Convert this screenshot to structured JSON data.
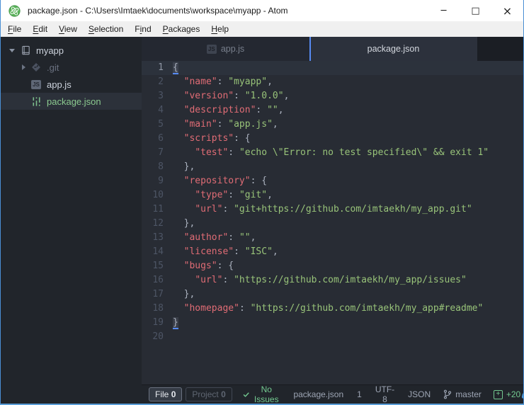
{
  "window": {
    "title": "package.json - C:\\Users\\Imtaek\\documents\\workspace\\myapp - Atom",
    "app_icon": "atom-logo",
    "controls": {
      "minimize": "─",
      "maximize": "□",
      "close": "×"
    }
  },
  "menu": {
    "items": [
      {
        "label": "File",
        "accel_index": 0
      },
      {
        "label": "Edit",
        "accel_index": 0
      },
      {
        "label": "View",
        "accel_index": 0
      },
      {
        "label": "Selection",
        "accel_index": 0
      },
      {
        "label": "Find",
        "accel_index": 1
      },
      {
        "label": "Packages",
        "accel_index": 0
      },
      {
        "label": "Help",
        "accel_index": 0
      }
    ]
  },
  "tree": {
    "root": {
      "label": "myapp",
      "icon": "repo-icon",
      "expanded": true
    },
    "items": [
      {
        "label": ".git",
        "icon": "git-folder-icon",
        "dim": true,
        "expandable": true
      },
      {
        "label": "app.js",
        "icon": "js-file-icon"
      },
      {
        "label": "package.json",
        "icon": "npm-package-icon",
        "selected": true,
        "git_status": "added"
      }
    ]
  },
  "tabs": [
    {
      "label": "app.js",
      "icon": "js-file-icon",
      "active": false
    },
    {
      "label": "package.json",
      "icon": "",
      "active": true
    }
  ],
  "editor": {
    "language": "JSON",
    "active_line": 1,
    "bracket_match_lines": [
      1,
      19
    ],
    "lines": [
      "{",
      "  \"name\": \"myapp\",",
      "  \"version\": \"1.0.0\",",
      "  \"description\": \"\",",
      "  \"main\": \"app.js\",",
      "  \"scripts\": {",
      "    \"test\": \"echo \\\"Error: no test specified\\\" && exit 1\"",
      "  },",
      "  \"repository\": {",
      "    \"type\": \"git\",",
      "    \"url\": \"git+https://github.com/imtaekh/my_app.git\"",
      "  },",
      "  \"author\": \"\",",
      "  \"license\": \"ISC\",",
      "  \"bugs\": {",
      "    \"url\": \"https://github.com/imtaekh/my_app/issues\"",
      "  },",
      "  \"homepage\": \"https://github.com/imtaekh/my_app#readme\"",
      "}",
      ""
    ]
  },
  "statusbar": {
    "file_issues": {
      "label": "File",
      "count": "0"
    },
    "project_issues": {
      "label": "Project",
      "count": "0"
    },
    "lint_status": "No Issues",
    "file_name": "package.json",
    "cursor_position": "1",
    "encoding": "UTF-8",
    "grammar": "JSON",
    "git_branch": "master",
    "git_added_count": "+20"
  },
  "colors": {
    "accent_blue": "#568af2",
    "key_red": "#e06c75",
    "string_green": "#98c379",
    "status_green": "#73c990",
    "squirrel_blue": "#4f9cdb",
    "window_border_blue": "#4a8fd4",
    "editor_bg": "#282c34",
    "panel_bg": "#21252b"
  }
}
